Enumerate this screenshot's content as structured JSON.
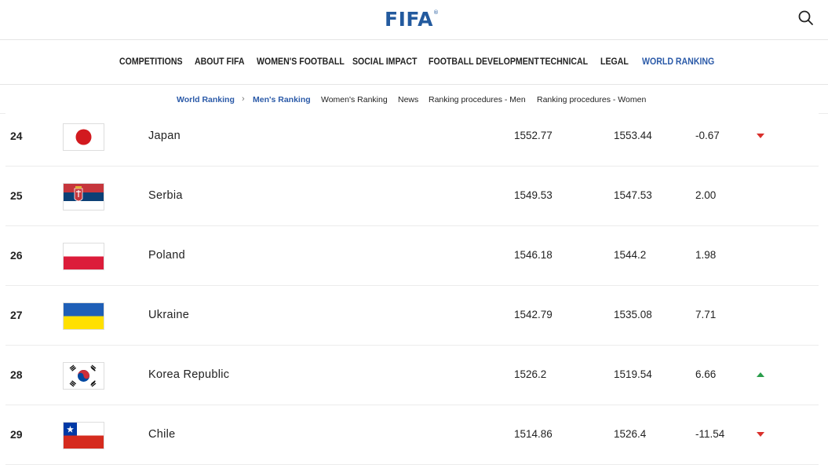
{
  "header": {
    "logo_text": "FIFA",
    "logo_mark": "®",
    "search_icon": "search-icon",
    "brand_color": "#235a9e"
  },
  "main_nav": {
    "items": [
      {
        "label": "COMPETITIONS",
        "active": false
      },
      {
        "label": "ABOUT FIFA",
        "active": false
      },
      {
        "label": "WOMEN'S FOOTBALL",
        "active": false
      },
      {
        "label": "SOCIAL IMPACT",
        "active": false
      },
      {
        "label": "FOOTBALL DEVELOPMENT",
        "active": false
      },
      {
        "label": "TECHNICAL",
        "active": false
      },
      {
        "label": "LEGAL",
        "active": false
      },
      {
        "label": "WORLD RANKING",
        "active": true
      }
    ],
    "active_color": "#2b5aa8"
  },
  "sub_nav": {
    "breadcrumb_root": "World Ranking",
    "breadcrumb_current": "Men's Ranking",
    "links": [
      "Women's Ranking",
      "News",
      "Ranking procedures - Men",
      "Ranking procedures - Women"
    ]
  },
  "rankings": [
    {
      "rank": "24",
      "team": "Japan",
      "flag": "japan-flag",
      "points": "1552.77",
      "previous_points": "1553.44",
      "change": "-0.67",
      "trend": "down"
    },
    {
      "rank": "25",
      "team": "Serbia",
      "flag": "serbia-flag",
      "points": "1549.53",
      "previous_points": "1547.53",
      "change": "2.00",
      "trend": "none"
    },
    {
      "rank": "26",
      "team": "Poland",
      "flag": "poland-flag",
      "points": "1546.18",
      "previous_points": "1544.2",
      "change": "1.98",
      "trend": "none"
    },
    {
      "rank": "27",
      "team": "Ukraine",
      "flag": "ukraine-flag",
      "points": "1542.79",
      "previous_points": "1535.08",
      "change": "7.71",
      "trend": "none"
    },
    {
      "rank": "28",
      "team": "Korea Republic",
      "flag": "korea-republic-flag",
      "points": "1526.2",
      "previous_points": "1519.54",
      "change": "6.66",
      "trend": "up"
    },
    {
      "rank": "29",
      "team": "Chile",
      "flag": "chile-flag",
      "points": "1514.86",
      "previous_points": "1526.4",
      "change": "-11.54",
      "trend": "down"
    }
  ],
  "colors": {
    "trend_down": "#d9302c",
    "trend_up": "#2a9d4b"
  }
}
